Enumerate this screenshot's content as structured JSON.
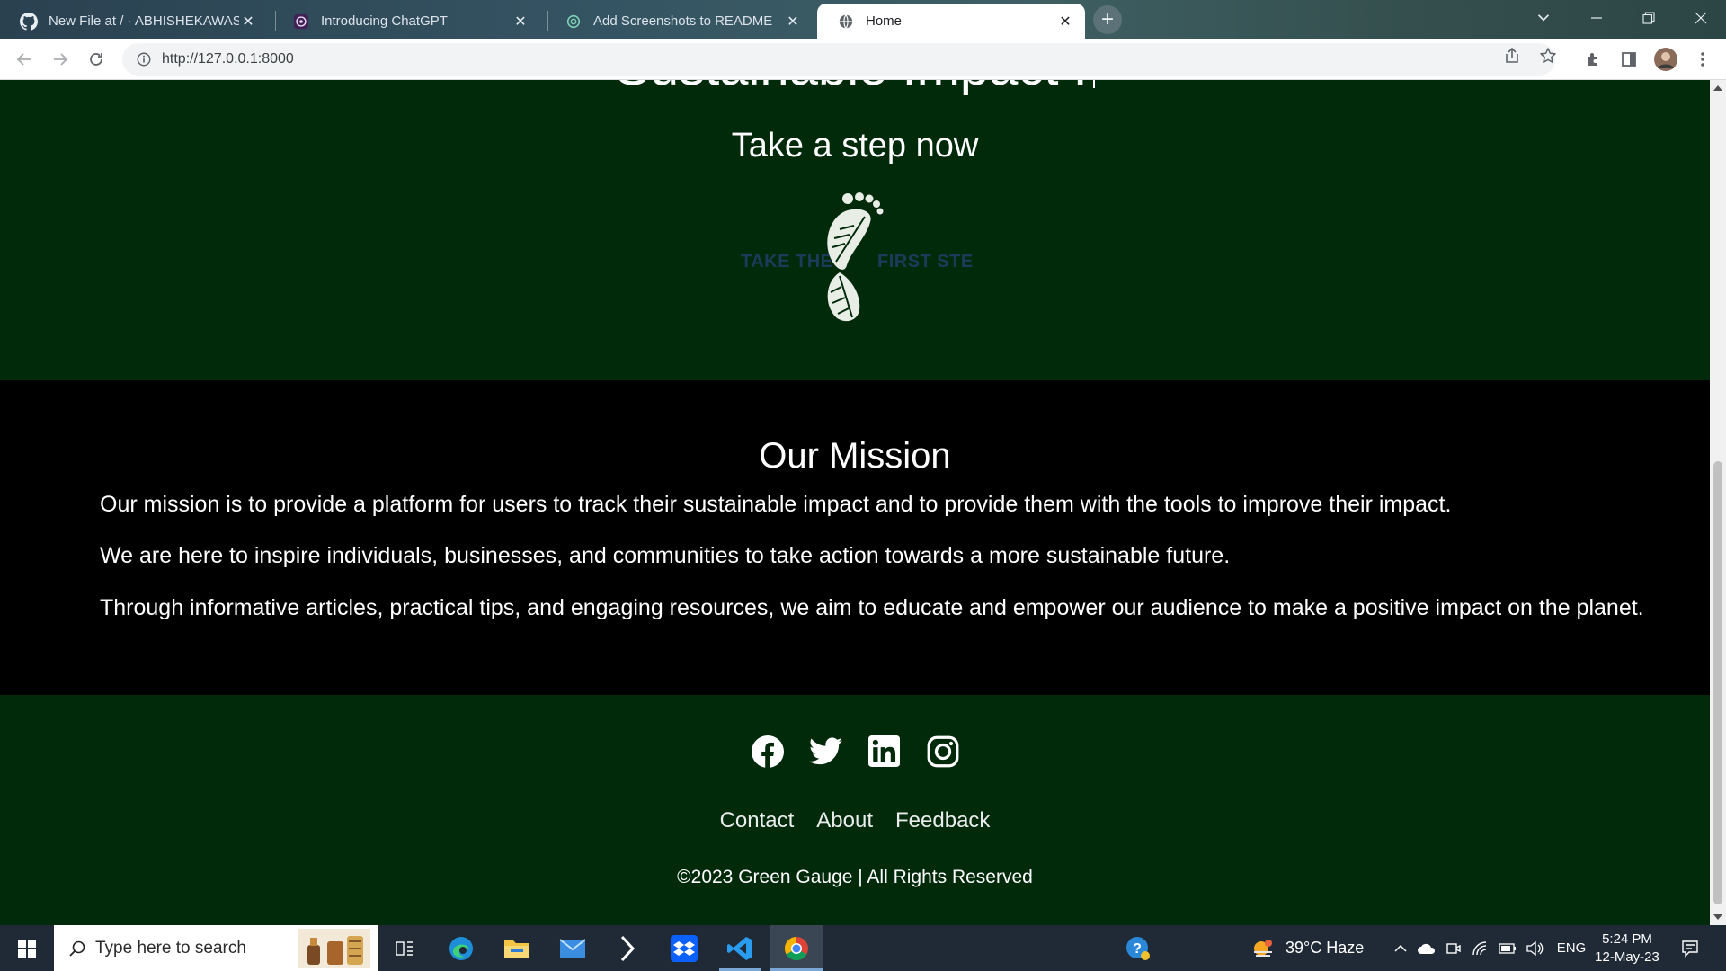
{
  "browser": {
    "tabs": [
      {
        "title": "New File at / · ABHISHEKAWASTHI",
        "icon": "github-icon",
        "active": false
      },
      {
        "title": "Introducing ChatGPT",
        "icon": "openai-icon",
        "active": false
      },
      {
        "title": "Add Screenshots to README",
        "icon": "openai-icon",
        "active": false
      },
      {
        "title": "Home",
        "icon": "globe-icon",
        "active": true
      }
    ],
    "close_glyph": "✕",
    "new_tab_glyph": "+",
    "url": "http://127.0.0.1:8000"
  },
  "hero": {
    "heading": "Sustainable Impact !",
    "subheading": "Take a step now",
    "logo_text_left": "TAKE THE",
    "logo_text_right": "FIRST STEP"
  },
  "mission": {
    "title": "Our Mission",
    "paragraphs": [
      "Our mission is to provide a platform for users to track their sustainable impact and to provide them with the tools to improve their impact.",
      "We are here to inspire individuals, businesses, and communities to take action towards a more sustainable future.",
      "Through informative articles, practical tips, and engaging resources, we aim to educate and empower our audience to make a positive impact on the planet."
    ]
  },
  "footer": {
    "social": [
      "facebook-icon",
      "twitter-icon",
      "linkedin-icon",
      "instagram-icon"
    ],
    "links": [
      "Contact",
      "About",
      "Feedback"
    ],
    "copyright": "©2023 Green Gauge | All Rights Reserved"
  },
  "taskbar": {
    "search_placeholder": "Type here to search",
    "weather": "39°C  Haze",
    "language": "ENG",
    "time": "5:24 PM",
    "date": "12-May-23"
  },
  "colors": {
    "hero_bg": "#012a0b",
    "mission_bg": "#000000",
    "footer_bg": "#012a0b",
    "logo_text": "#1c3b5a"
  }
}
